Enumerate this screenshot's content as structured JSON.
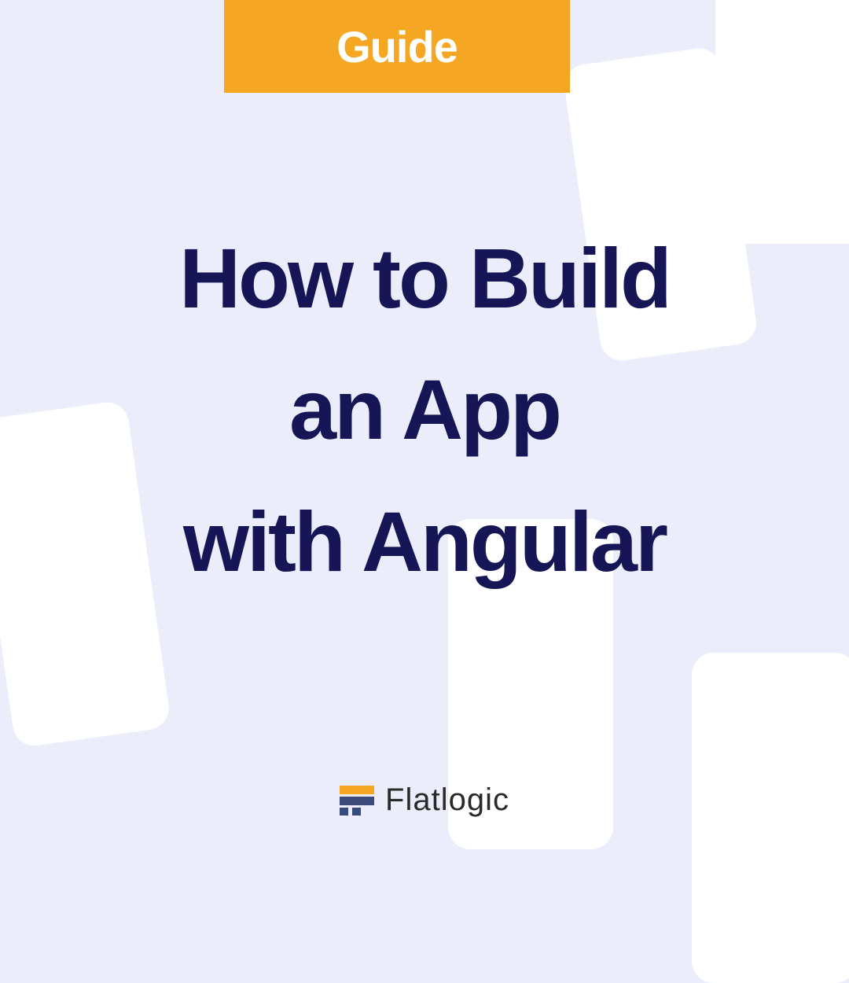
{
  "badge": {
    "label": "Guide"
  },
  "title": {
    "line1": "How to Build",
    "line2": "an App",
    "line3": "with Angular"
  },
  "footer": {
    "brand": "Flatlogic"
  },
  "colors": {
    "background": "#ebeefa",
    "badge_bg": "#f5a623",
    "badge_text": "#ffffff",
    "title_text": "#161657",
    "brand_text": "#2a2a2a",
    "shape": "#ffffff"
  }
}
